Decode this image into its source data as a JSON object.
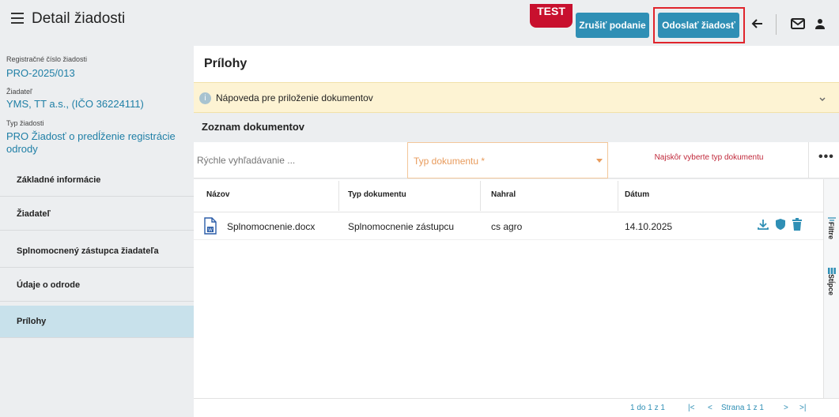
{
  "header": {
    "title": "Detail žiadosti",
    "test_badge": "TEST",
    "cancel_label": "Zrušiť podanie",
    "send_label": "Odoslať žiadosť"
  },
  "sidebar": {
    "reg_label": "Registračné číslo žiadosti",
    "reg_value": "PRO-2025/013",
    "applicant_label": "Žiadateľ",
    "applicant_value": "YMS, TT a.s., (IČO 36224111)",
    "type_label": "Typ žiadosti",
    "type_value_line1": "PRO Žiadosť o predĺženie registrácie",
    "type_value_line2": "odrody",
    "items": [
      {
        "label": "Základné informácie"
      },
      {
        "label": "Žiadateľ"
      },
      {
        "label": "Splnomocnený zástupca žiadateľa"
      },
      {
        "label": "Údaje o odrode"
      },
      {
        "label": "Prílohy",
        "active": true
      }
    ]
  },
  "main": {
    "title": "Prílohy",
    "help": "Nápoveda pre priloženie dokumentov",
    "docs_title": "Zoznam dokumentov",
    "search_placeholder": "Rýchle vyhľadávanie ...",
    "type_placeholder": "Typ dokumentu *",
    "upload_hint": "Najskôr vyberte typ dokumentu",
    "more": "•••",
    "columns": [
      "Názov",
      "Typ dokumentu",
      "Nahral",
      "Dátum"
    ],
    "rows": [
      {
        "name": "Splnomocnenie.docx",
        "type": "Splnomocnenie zástupcu",
        "uploader": "cs agro",
        "date": "14.10.2025"
      }
    ],
    "rail": {
      "filter": "Filtre",
      "columns": "Stĺpce"
    },
    "pager": {
      "range": "1 do 1 z 1",
      "page": "Strana 1 z 1"
    }
  },
  "colors": {
    "accent": "#2f8fb5",
    "test": "#c8102e",
    "highlight": "#e0242c",
    "active_nav": "#c8e1eb",
    "help_bg": "#fdf3d3"
  }
}
